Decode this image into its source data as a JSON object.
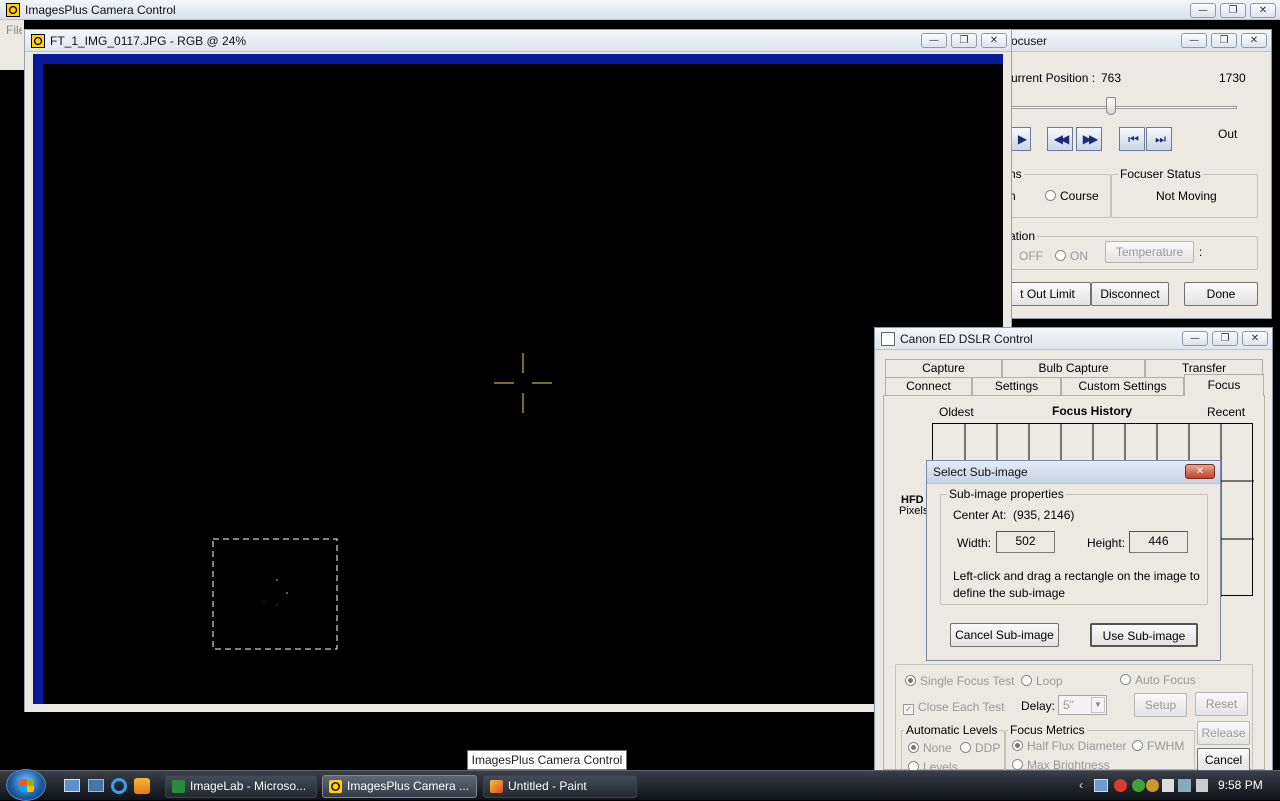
{
  "main_window": {
    "title": "ImagesPlus Camera Control",
    "menu_first": "File"
  },
  "image_window": {
    "title": "FT_1_IMG_0117.JPG - RGB @ 24%"
  },
  "focuser": {
    "title": "ocuser",
    "current_position_label": "urrent Position :",
    "current_position": "763",
    "max_position": "1730",
    "out_label": "Out",
    "slider_fraction": 0.441,
    "steps_group_label": "ns",
    "fine_partial": "n",
    "course_label": "Course",
    "status_group_label": "Focuser Status",
    "status_value": "Not Moving",
    "temp_group_label": "ation",
    "off_label": "OFF",
    "on_label": "ON",
    "temperature_button": "Temperature",
    "temp_colon": ":",
    "set_out_limit_button": "t Out Limit",
    "disconnect_button": "Disconnect",
    "done_button": "Done"
  },
  "dslr": {
    "title": "Canon ED DSLR Control",
    "tabs_back": [
      "Capture",
      "Bulb Capture",
      "Transfer"
    ],
    "tabs_front": [
      "Connect",
      "Settings",
      "Custom Settings",
      "Focus"
    ],
    "oldest_label": "Oldest",
    "history_title": "Focus History",
    "recent_label": "Recent",
    "hfd_label": "HFD",
    "pixels_label": "Pixels",
    "single_focus_test": "Single Focus Test",
    "loop": "Loop",
    "auto_focus": "Auto Focus",
    "close_each_test": "Close Each Test",
    "delay_label": "Delay:",
    "delay_value": "5\"",
    "setup_button": "Setup",
    "reset_button": "Reset",
    "release_button": "Release",
    "cancel_button": "Cancel",
    "auto_levels_label": "Automatic Levels",
    "none_label": "None",
    "ddp_label": "DDP",
    "levels_label": "Levels",
    "focus_metrics_label": "Focus Metrics",
    "half_flux_label": "Half Flux Diameter",
    "fwhm_label": "FWHM",
    "max_brightness_label": "Max Brightness"
  },
  "subimage": {
    "title": "Select Sub-image",
    "group_label": "Sub-image properties",
    "center_label": "Center At:",
    "center_value": "(935, 2146)",
    "width_label": "Width:",
    "width_value": "502",
    "height_label": "Height:",
    "height_value": "446",
    "instructions_line1": "Left-click and drag a rectangle on the image to",
    "instructions_line2": "define the sub-image",
    "cancel_button": "Cancel Sub-image",
    "use_button": "Use Sub-image"
  },
  "tooltip": "ImagesPlus Camera Control",
  "taskbar": {
    "tasks": [
      "ImageLab - Microso...",
      "ImagesPlus Camera ...",
      "Untitled - Paint"
    ],
    "clock": "9:58 PM"
  },
  "colors": {
    "accent": "#1a2a7a",
    "image_border": "#0a1a9a",
    "crosshair": "#e8d36a"
  }
}
